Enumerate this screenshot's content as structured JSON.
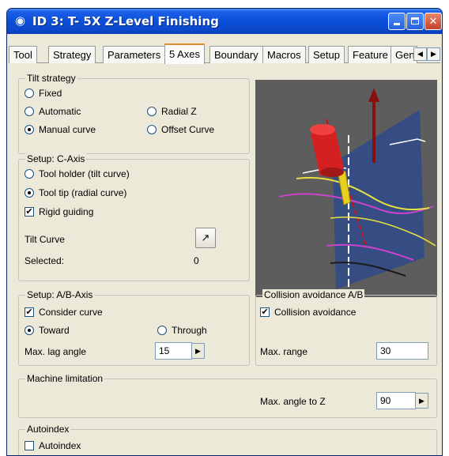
{
  "window": {
    "title": "ID 3: T- 5X Z-Level Finishing"
  },
  "tabs": [
    "Tool",
    "Strategy",
    "Parameters",
    "5 Axes",
    "Boundary",
    "Macros",
    "Setup",
    "Feature",
    "Gen"
  ],
  "active_tab": "5 Axes",
  "tilt_strategy": {
    "legend": "Tilt strategy",
    "options": [
      {
        "label": "Fixed",
        "selected": false
      },
      {
        "label": "Automatic",
        "selected": false
      },
      {
        "label": "Radial Z",
        "selected": false
      },
      {
        "label": "Manual curve",
        "selected": true
      },
      {
        "label": "Offset Curve",
        "selected": false
      }
    ]
  },
  "setup_c": {
    "legend": "Setup: C-Axis",
    "tool_holder": "Tool holder (tilt curve)",
    "tool_tip": "Tool tip (radial curve)",
    "rigid_guiding": "Rigid guiding",
    "tilt_curve_label": "Tilt Curve",
    "selected_label": "Selected:",
    "selected_value": "0"
  },
  "setup_ab": {
    "legend": "Setup: A/B-Axis",
    "consider_curve": "Consider curve",
    "toward": "Toward",
    "through": "Through",
    "max_lag_label": "Max. lag angle",
    "max_lag_value": "15"
  },
  "collision": {
    "legend": "Collision avoidance A/B",
    "checkbox": "Collision avoidance",
    "max_range_label": "Max. range",
    "max_range_value": "30"
  },
  "machine": {
    "legend": "Machine limitation",
    "max_angle_label": "Max. angle to Z",
    "max_angle_value": "90"
  },
  "autoindex": {
    "legend": "Autoindex",
    "checkbox": "Autoindex"
  },
  "glyphs": {
    "check": "✔",
    "arrow_right": "▶",
    "arrow_left": "◀",
    "close": "✕"
  },
  "colors": {
    "title_blue": "#0b4fd8",
    "active_tab_orange": "#e68b2c",
    "dialog_bg": "#ece9d8"
  }
}
